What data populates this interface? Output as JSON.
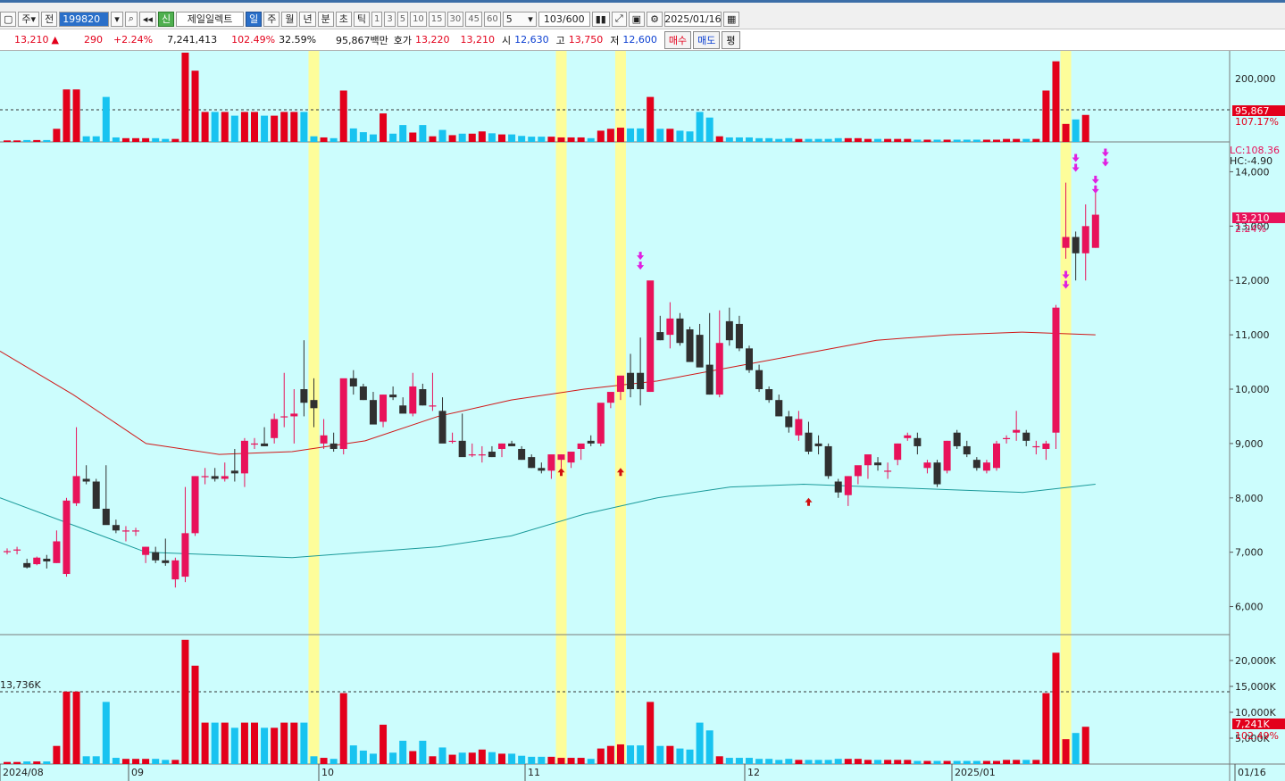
{
  "toolbar": {
    "market_label": "주",
    "prefix_label": "전",
    "code": "199820",
    "company": "제일일렉트",
    "credit_badge": "신",
    "periods": [
      "일",
      "주",
      "월",
      "년",
      "분",
      "초",
      "틱"
    ],
    "active_period": "일",
    "intervals": [
      "1",
      "3",
      "5",
      "10",
      "15",
      "30",
      "45",
      "60"
    ],
    "unit_value": "5",
    "count": "103/600",
    "date": "2025/01/16"
  },
  "quote": {
    "price": "13,210",
    "change": "290",
    "change_pct": "+2.24%",
    "volume": "7,241,413",
    "volume_ratio": "102.49%",
    "turnover": "32.59%",
    "amount": "95,867백만",
    "hoga_label": "호가",
    "ask": "13,220",
    "bid": "13,210",
    "open_label": "시",
    "open": "12,630",
    "high_label": "고",
    "high": "13,750",
    "low_label": "저",
    "low": "12,600",
    "buy_label": "매수",
    "sell_label": "매도",
    "avg_label": "평"
  },
  "colors": {
    "background": "#ccfdfd",
    "up": "#e8125a",
    "down": "#303030",
    "vol_up": "#e3001b",
    "vol_down": "#18c3f0",
    "highlight": "#fdfd9a",
    "ma_red": "#d01818",
    "ma_teal": "#1a9a9a",
    "signal": "#e020e0"
  },
  "chart_data": {
    "type": "candlestick",
    "x_labels": [
      "2024/08",
      "09",
      "10",
      "11",
      "12",
      "2025/01",
      "01/16"
    ],
    "price_axis": [
      "14,000",
      "13,000",
      "12,000",
      "11,000",
      "10,000",
      "9,000",
      "8,000",
      "7,000",
      "6,000"
    ],
    "price_ylim": [
      5500,
      14500
    ],
    "current_price_tag": "13,210",
    "current_pct_tag": "2.24%",
    "indicator_labels": [
      "LC:108.36",
      "HC:-4.90"
    ],
    "top_volume_axis": [
      "200,000"
    ],
    "top_volume_ref_tag": "95,867",
    "top_volume_pct_tag": "107.17%",
    "volume_axis": [
      "20,000K",
      "15,000K",
      "10,000K",
      "5,000K"
    ],
    "volume_ref_label": "13,736K",
    "volume_tag": "7,241K",
    "volume_pct_tag": "102.49%",
    "candles": [
      [
        7020,
        7070,
        6960,
        7020
      ],
      [
        7030,
        7100,
        6960,
        7050
      ],
      [
        6800,
        6880,
        6700,
        6720
      ],
      [
        6780,
        6920,
        6760,
        6900
      ],
      [
        6880,
        6950,
        6700,
        6830
      ],
      [
        6800,
        7400,
        6800,
        7200
      ],
      [
        6600,
        8000,
        6550,
        7950
      ],
      [
        7900,
        9300,
        7850,
        8400
      ],
      [
        8350,
        8600,
        8250,
        8300
      ],
      [
        8300,
        8350,
        7800,
        7800
      ],
      [
        7800,
        8600,
        7650,
        7500
      ],
      [
        7500,
        7600,
        7350,
        7400
      ],
      [
        7400,
        7480,
        7200,
        7400
      ],
      [
        7400,
        7450,
        7300,
        7400
      ],
      [
        6950,
        7100,
        6800,
        7100
      ],
      [
        7000,
        7100,
        6800,
        6850
      ],
      [
        6850,
        7250,
        6750,
        6800
      ],
      [
        6500,
        6900,
        6350,
        6850
      ],
      [
        6550,
        8200,
        6450,
        7350
      ],
      [
        7350,
        8400,
        7300,
        8400
      ],
      [
        8400,
        8550,
        8250,
        8400
      ],
      [
        8400,
        8550,
        8300,
        8350
      ],
      [
        8350,
        8650,
        8300,
        8400
      ],
      [
        8500,
        8900,
        8300,
        8450
      ],
      [
        8450,
        9100,
        8200,
        9050
      ],
      [
        9000,
        9100,
        8900,
        9000
      ],
      [
        9000,
        9300,
        8950,
        8950
      ],
      [
        9100,
        9550,
        9000,
        9450
      ],
      [
        9500,
        10300,
        9300,
        9500
      ],
      [
        9500,
        10000,
        9000,
        9550
      ],
      [
        10000,
        10900,
        9500,
        9750
      ],
      [
        9800,
        10200,
        9300,
        9650
      ],
      [
        9000,
        9450,
        8900,
        9150
      ],
      [
        9000,
        9200,
        8850,
        8900
      ],
      [
        8900,
        9500,
        8800,
        10200
      ],
      [
        10200,
        10350,
        9900,
        10050
      ],
      [
        10050,
        10100,
        9800,
        9800
      ],
      [
        9800,
        9950,
        9450,
        9350
      ],
      [
        9400,
        9900,
        9300,
        9900
      ],
      [
        9900,
        10050,
        9800,
        9850
      ],
      [
        9700,
        9850,
        9600,
        9550
      ],
      [
        9550,
        10300,
        9500,
        10050
      ],
      [
        10000,
        10100,
        9700,
        9700
      ],
      [
        9700,
        10300,
        9600,
        9700
      ],
      [
        9600,
        9850,
        9300,
        9000
      ],
      [
        9050,
        9200,
        9000,
        9050
      ],
      [
        9050,
        9550,
        8950,
        8750
      ],
      [
        8800,
        9000,
        8750,
        8800
      ],
      [
        8800,
        8950,
        8650,
        8800
      ],
      [
        8850,
        8950,
        8750,
        8750
      ],
      [
        8900,
        9000,
        8750,
        9000
      ],
      [
        9000,
        9050,
        8950,
        8950
      ],
      [
        8900,
        8950,
        8700,
        8700
      ],
      [
        8750,
        8800,
        8550,
        8550
      ],
      [
        8550,
        8650,
        8450,
        8500
      ],
      [
        8500,
        8600,
        8350,
        8800
      ],
      [
        8700,
        8800,
        8550,
        8800
      ],
      [
        8650,
        8700,
        8550,
        8850
      ],
      [
        8900,
        8950,
        8700,
        9000
      ],
      [
        9050,
        9150,
        8950,
        9000
      ],
      [
        9000,
        9300,
        8950,
        9750
      ],
      [
        9750,
        9800,
        9650,
        9950
      ],
      [
        9950,
        10000,
        9800,
        10250
      ],
      [
        10300,
        10650,
        9850,
        10000
      ],
      [
        10300,
        10950,
        9700,
        10000
      ],
      [
        9950,
        11950,
        9950,
        12000
      ],
      [
        11050,
        11350,
        10900,
        10900
      ],
      [
        11000,
        11600,
        10750,
        11300
      ],
      [
        11300,
        11400,
        10800,
        10850
      ],
      [
        11100,
        11150,
        10700,
        10500
      ],
      [
        11000,
        11200,
        10550,
        10400
      ],
      [
        10450,
        11400,
        9900,
        9900
      ],
      [
        9900,
        11450,
        9850,
        10850
      ],
      [
        11250,
        11500,
        10800,
        10900
      ],
      [
        11200,
        11350,
        10700,
        10750
      ],
      [
        10750,
        10800,
        10300,
        10350
      ],
      [
        10350,
        10450,
        9950,
        10000
      ],
      [
        10000,
        10050,
        9750,
        9800
      ],
      [
        9800,
        9900,
        9500,
        9500
      ],
      [
        9500,
        9600,
        9200,
        9300
      ],
      [
        9150,
        9600,
        9050,
        9450
      ],
      [
        9200,
        9400,
        8800,
        8850
      ],
      [
        9000,
        9150,
        8800,
        8950
      ],
      [
        8950,
        9000,
        8350,
        8400
      ],
      [
        8300,
        8350,
        8000,
        8100
      ],
      [
        8050,
        8400,
        7850,
        8400
      ],
      [
        8400,
        8500,
        8250,
        8600
      ],
      [
        8600,
        8650,
        8350,
        8800
      ],
      [
        8650,
        8750,
        8500,
        8600
      ],
      [
        8500,
        8650,
        8350,
        8500
      ],
      [
        8700,
        9000,
        8600,
        9000
      ],
      [
        9100,
        9200,
        9050,
        9150
      ],
      [
        9100,
        9200,
        8800,
        8950
      ],
      [
        8550,
        8700,
        8450,
        8650
      ],
      [
        8650,
        8700,
        8200,
        8250
      ],
      [
        8500,
        9050,
        8450,
        9050
      ],
      [
        9200,
        9250,
        8900,
        8950
      ],
      [
        8950,
        9050,
        8750,
        8800
      ],
      [
        8700,
        8750,
        8500,
        8550
      ],
      [
        8500,
        8700,
        8450,
        8650
      ],
      [
        8550,
        9050,
        8500,
        9000
      ],
      [
        9100,
        9150,
        9000,
        9100
      ],
      [
        9200,
        9600,
        9050,
        9250
      ],
      [
        9200,
        9250,
        8950,
        9050
      ],
      [
        8950,
        9050,
        8800,
        8950
      ],
      [
        8900,
        9050,
        8700,
        9000
      ],
      [
        9200,
        11550,
        8900,
        11500
      ],
      [
        12600,
        13800,
        12400,
        12800
      ],
      [
        12800,
        12900,
        12000,
        12500
      ],
      [
        12500,
        13400,
        12000,
        13000
      ],
      [
        12600,
        13750,
        12600,
        13210
      ]
    ],
    "ma_red": [
      [
        0,
        10700
      ],
      [
        20,
        9900
      ],
      [
        40,
        9000
      ],
      [
        60,
        8800
      ],
      [
        80,
        8850
      ],
      [
        100,
        9050
      ],
      [
        120,
        9500
      ],
      [
        140,
        9800
      ],
      [
        160,
        10000
      ],
      [
        180,
        10150
      ],
      [
        200,
        10400
      ],
      [
        220,
        10650
      ],
      [
        240,
        10900
      ],
      [
        260,
        11000
      ],
      [
        280,
        11050
      ],
      [
        300,
        11000
      ]
    ],
    "ma_teal": [
      [
        0,
        8000
      ],
      [
        20,
        7500
      ],
      [
        40,
        7000
      ],
      [
        60,
        6950
      ],
      [
        80,
        6900
      ],
      [
        100,
        7000
      ],
      [
        120,
        7100
      ],
      [
        140,
        7300
      ],
      [
        160,
        7700
      ],
      [
        180,
        8000
      ],
      [
        200,
        8200
      ],
      [
        220,
        8250
      ],
      [
        240,
        8200
      ],
      [
        260,
        8150
      ],
      [
        280,
        8100
      ],
      [
        300,
        8250
      ]
    ],
    "volume": [
      0.4,
      0.4,
      0.5,
      0.5,
      0.5,
      3.5,
      14,
      14,
      1.5,
      1.5,
      12,
      1.2,
      1,
      1,
      1,
      1,
      0.8,
      0.8,
      24,
      19,
      8,
      8,
      8,
      7,
      8,
      8,
      7,
      7,
      8,
      8,
      8,
      1.5,
      1.2,
      1,
      13.7,
      3.6,
      2.6,
      2,
      7.6,
      2.2,
      4.5,
      2.5,
      4.5,
      1.5,
      3.2,
      1.8,
      2.2,
      2.2,
      2.8,
      2.3,
      2,
      2,
      1.6,
      1.4,
      1.4,
      1.4,
      1.2,
      1.2,
      1.2,
      1,
      3,
      3.5,
      3.8,
      3.6,
      3.6,
      12,
      3.5,
      3.5,
      3,
      2.8,
      8,
      6.5,
      1.5,
      1.2,
      1.2,
      1.2,
      1,
      1,
      0.8,
      1,
      0.8,
      0.8,
      0.8,
      0.8,
      1,
      1,
      1,
      0.8,
      0.8,
      0.8,
      0.8,
      0.8,
      0.6,
      0.6,
      0.6,
      0.6,
      0.6,
      0.6,
      0.6,
      0.6,
      0.6,
      0.8,
      0.8,
      0.8,
      0.8,
      13.7,
      21.5,
      4.8,
      6,
      7.2
    ],
    "highlight_indices": [
      31,
      56,
      62,
      107
    ]
  }
}
